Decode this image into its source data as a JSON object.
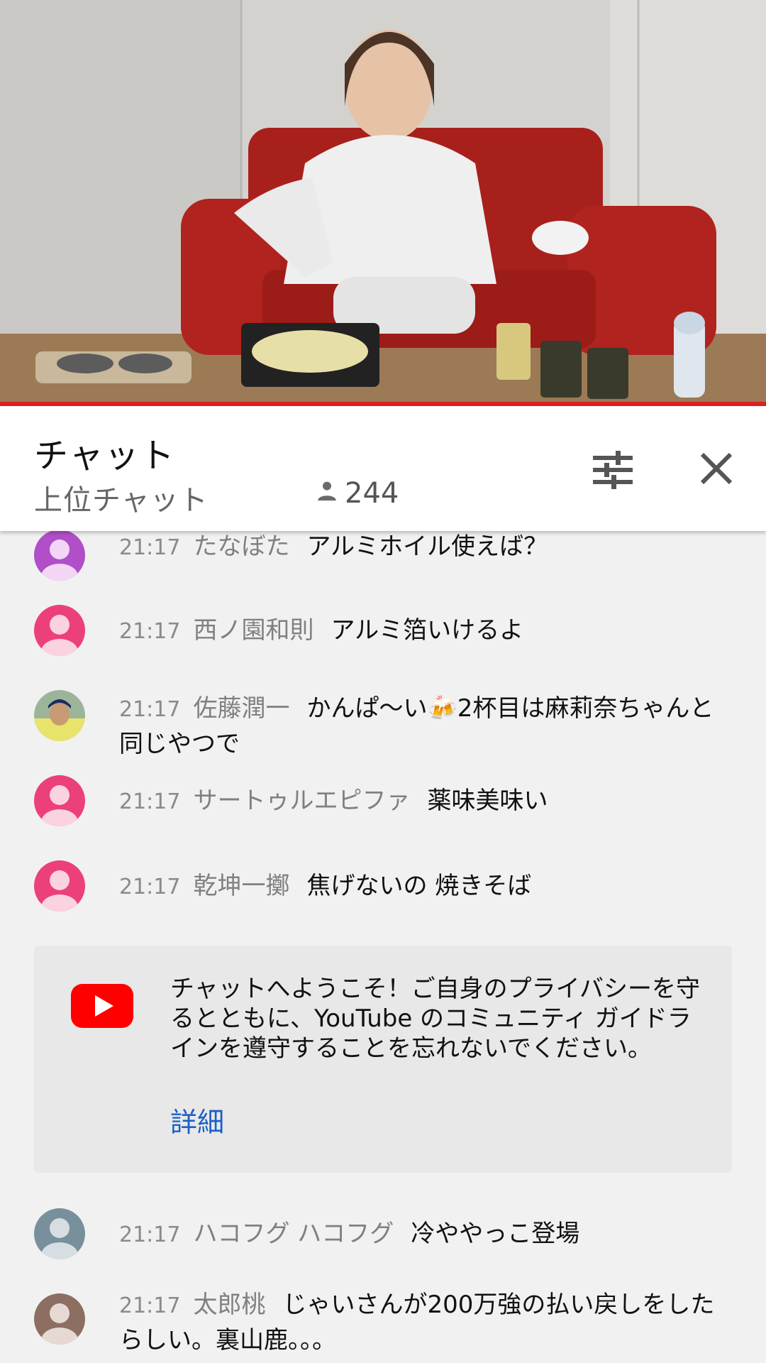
{
  "player": {
    "progress_percent": 100
  },
  "chat_header": {
    "title": "チャット",
    "mode": "上位チャット",
    "viewer_count": "244",
    "icons": {
      "viewers": "person-icon",
      "filter": "tune-icon",
      "close": "close-icon"
    }
  },
  "messages": [
    {
      "time": "21:17",
      "author": "たなぼた",
      "text": "アルミホイル使えば？",
      "avatar_color": "#b04fc7"
    },
    {
      "time": "21:17",
      "author": "西ノ園和則",
      "text": "アルミ箔いけるよ",
      "avatar_color": "#ec407a"
    },
    {
      "time": "21:17",
      "author": "佐藤潤一",
      "text": "かんぱ〜い🍻2杯目は麻莉奈ちゃんと同じやつで",
      "avatar_color": "photo"
    },
    {
      "time": "21:17",
      "author": "サートゥルエピファ",
      "text": "薬味美味い",
      "avatar_color": "#ec407a"
    },
    {
      "time": "21:17",
      "author": "乾坤一擲",
      "text": "焦げないの 焼きそば",
      "avatar_color": "#ec407a"
    },
    {
      "time": "21:17",
      "author": "ハコフグ ハコフグ",
      "text": "冷ややっこ登場",
      "avatar_color": "#78909c"
    },
    {
      "time": "21:17",
      "author": "太郎桃",
      "text": "じゃいさんが200万強の払い戻しをしたらしい。裏山鹿。。。",
      "avatar_color": "#8d6e63"
    }
  ],
  "welcome": {
    "text": "チャットへようこそ！ご自身のプライバシーを守るとともに、YouTube のコミュニティ ガイドラインを遵守することを忘れないでください。",
    "link": "詳細",
    "logo": "youtube-logo-icon",
    "colors": {
      "logo": "#ff0000",
      "link": "#1a5fc8"
    }
  }
}
